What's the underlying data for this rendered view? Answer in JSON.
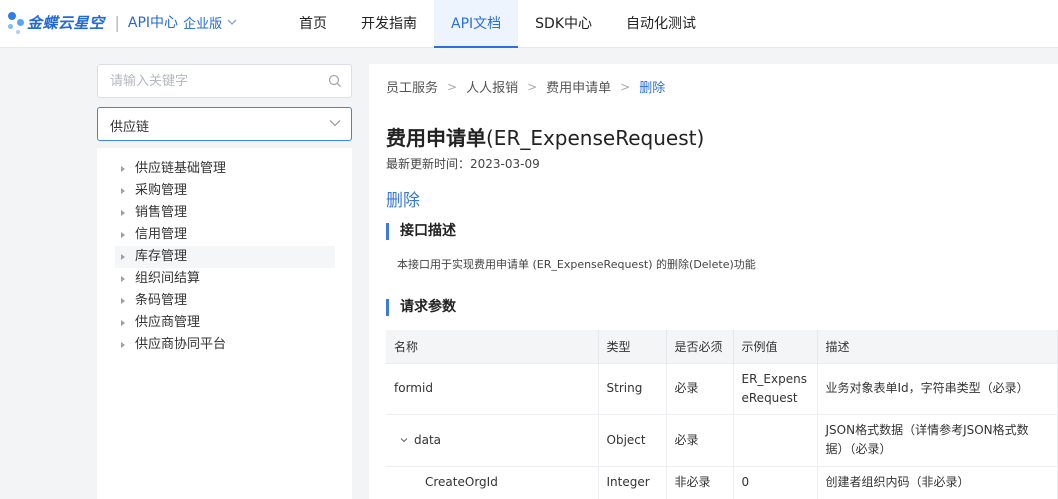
{
  "header": {
    "logo_text": "金蝶云星空",
    "logo_subtitle": "API中心",
    "edition": "企业版",
    "nav": [
      {
        "label": "首页",
        "active": false
      },
      {
        "label": "开发指南",
        "active": false
      },
      {
        "label": "API文档",
        "active": true
      },
      {
        "label": "SDK中心",
        "active": false
      },
      {
        "label": "自动化测试",
        "active": false
      }
    ]
  },
  "sidebar": {
    "search_placeholder": "请输入关键字",
    "selected_module": "供应链",
    "items": [
      {
        "label": "供应链基础管理"
      },
      {
        "label": "采购管理"
      },
      {
        "label": "销售管理"
      },
      {
        "label": "信用管理"
      },
      {
        "label": "库存管理"
      },
      {
        "label": "组织间结算"
      },
      {
        "label": "条码管理"
      },
      {
        "label": "供应商管理"
      },
      {
        "label": "供应商协同平台"
      }
    ]
  },
  "breadcrumb": [
    "员工服务",
    "人人报销",
    "费用申请单",
    "删除"
  ],
  "doc": {
    "title_cn": "费用申请单",
    "title_code": "(ER_ExpenseRequest)",
    "updated": "最新更新时间：2023-03-09",
    "operation": "删除",
    "desc_heading": "接口描述",
    "description": "本接口用于实现费用申请单 (ER_ExpenseRequest) 的删除(Delete)功能",
    "params_heading": "请求参数"
  },
  "params_table": {
    "headers": [
      "名称",
      "类型",
      "是否必须",
      "示例值",
      "描述"
    ],
    "rows": [
      {
        "name": "formid",
        "type": "String",
        "required": "必录",
        "example_line1": "ER_Expens",
        "example_line2": "eRequest",
        "desc": "业务对象表单Id，字符串类型（必录）"
      },
      {
        "name": "data",
        "type": "Object",
        "required": "必录",
        "example": "",
        "desc_line1": "JSON格式数据（详情参考JSON格式数",
        "desc_line2": "据）（必录）"
      },
      {
        "name": "CreateOrgId",
        "type": "Integer",
        "required": "非必录",
        "example": "0",
        "desc": "创建者组织内码（非必录）"
      }
    ]
  },
  "colors": {
    "accent": "#2a6fdb",
    "nav_active_bg": "#eef4fd",
    "page_bg": "#f3f4f6"
  }
}
